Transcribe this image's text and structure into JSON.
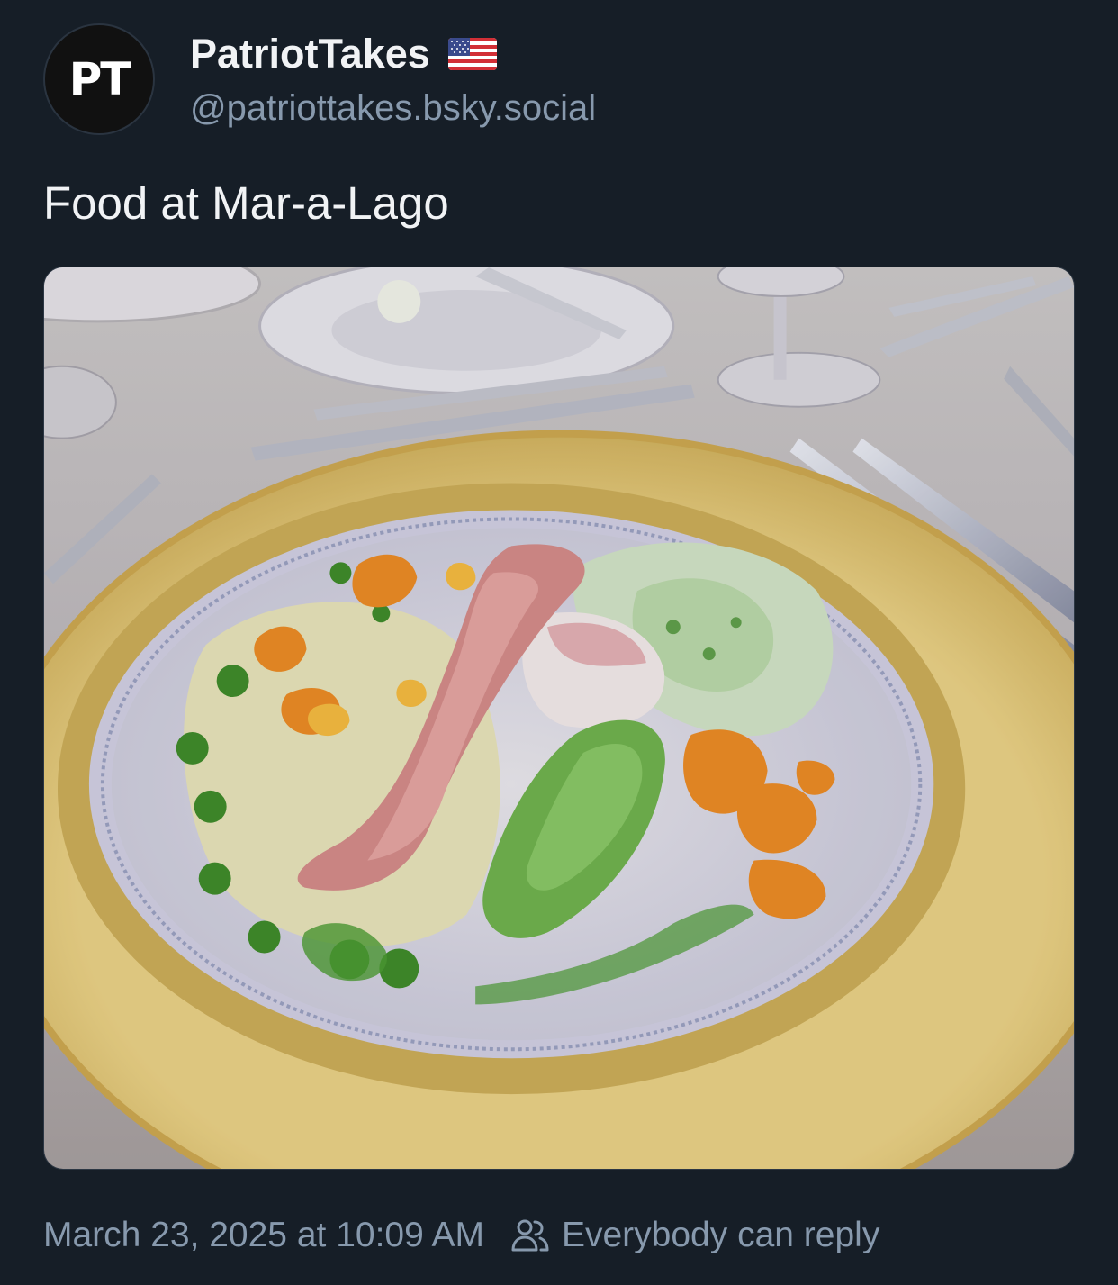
{
  "author": {
    "avatar_initials": "PT",
    "display_name": "PatriotTakes",
    "flag_icon": "us-flag-icon",
    "handle": "@patriottakes.bsky.social"
  },
  "post": {
    "text": "Food at Mar-a-Lago",
    "image": {
      "icon": "photo-food-plate"
    }
  },
  "meta": {
    "timestamp": "March 23, 2025 at 10:09 AM",
    "reply_icon": "people-icon",
    "reply_setting": "Everybody can reply"
  },
  "colors": {
    "background": "#161e27",
    "text_primary": "#f1f3f5",
    "text_secondary": "#8799ad"
  }
}
